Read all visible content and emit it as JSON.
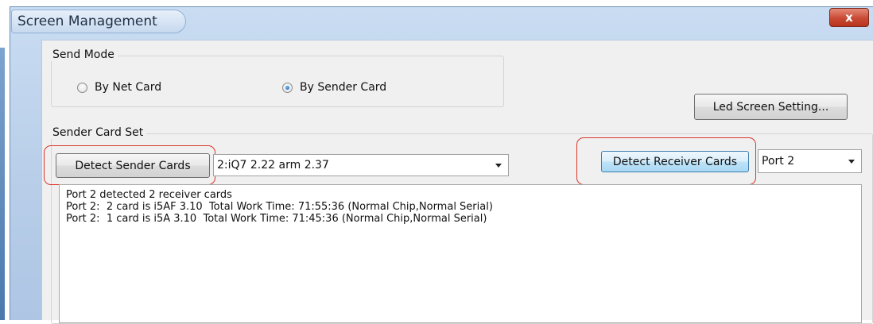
{
  "window": {
    "title": "Screen Management",
    "close_label": "x"
  },
  "send_mode": {
    "label": "Send Mode",
    "options": [
      {
        "label": "By Net Card",
        "selected": false
      },
      {
        "label": "By Sender Card",
        "selected": true
      }
    ]
  },
  "led_setting_button": "Led Screen Setting...",
  "sender_card_set": {
    "label": "Sender Card Set",
    "detect_sender_label": "Detect Sender Cards",
    "sender_select_value": "2:iQ7   2.22 arm 2.37",
    "detect_receiver_label": "Detect Receiver Cards",
    "port_select_value": "Port 2"
  },
  "log_lines": [
    "Port 2 detected 2 receiver cards",
    "Port 2:  2 card is i5AF 3.10  Total Work Time: 71:55:36 (Normal Chip,Normal Serial)",
    "Port 2:  1 card is i5A 3.10  Total Work Time: 71:45:36 (Normal Chip,Normal Serial)"
  ],
  "colors": {
    "highlight": "#d9362b",
    "title_bar": "#b7cde8",
    "close_button": "#c94a34"
  }
}
